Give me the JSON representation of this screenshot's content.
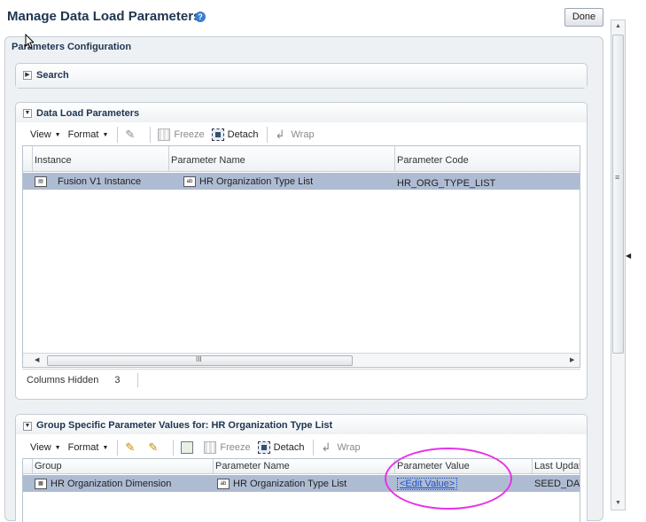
{
  "window": {
    "title": "Manage Data Load Parameters",
    "help_glyph": "?",
    "done_label": "Done"
  },
  "outer_section": {
    "title": "Parameters Configuration"
  },
  "search_section": {
    "title": "Search"
  },
  "data_load": {
    "title": "Data Load Parameters",
    "toolbar": {
      "view": "View",
      "format": "Format",
      "freeze": "Freeze",
      "detach": "Detach",
      "wrap": "Wrap"
    },
    "columns": [
      "Instance",
      "Parameter Name",
      "Parameter Code"
    ],
    "rows": [
      {
        "instance": "Fusion V1 Instance",
        "parameter_name": "HR Organization Type List",
        "parameter_code": "HR_ORG_TYPE_LIST"
      }
    ],
    "columns_hidden_label": "Columns Hidden",
    "columns_hidden_count": "3",
    "scroll_grip": "III"
  },
  "group_specific": {
    "title": "Group Specific Parameter Values for: HR Organization Type List",
    "toolbar": {
      "view": "View",
      "format": "Format",
      "freeze": "Freeze",
      "detach": "Detach",
      "wrap": "Wrap"
    },
    "columns": [
      "Group",
      "Parameter Name",
      "Parameter Value",
      "Last Updat"
    ],
    "rows": [
      {
        "group": "HR Organization Dimension",
        "parameter_name": "HR Organization Type List",
        "parameter_value": "<Edit Value>",
        "last_updated": "SEED_DAT/"
      }
    ]
  },
  "colors": {
    "selected_row": "#aebcd3",
    "annotation": "#e632e6",
    "title": "#1e3550",
    "link": "#1f4fc6"
  }
}
